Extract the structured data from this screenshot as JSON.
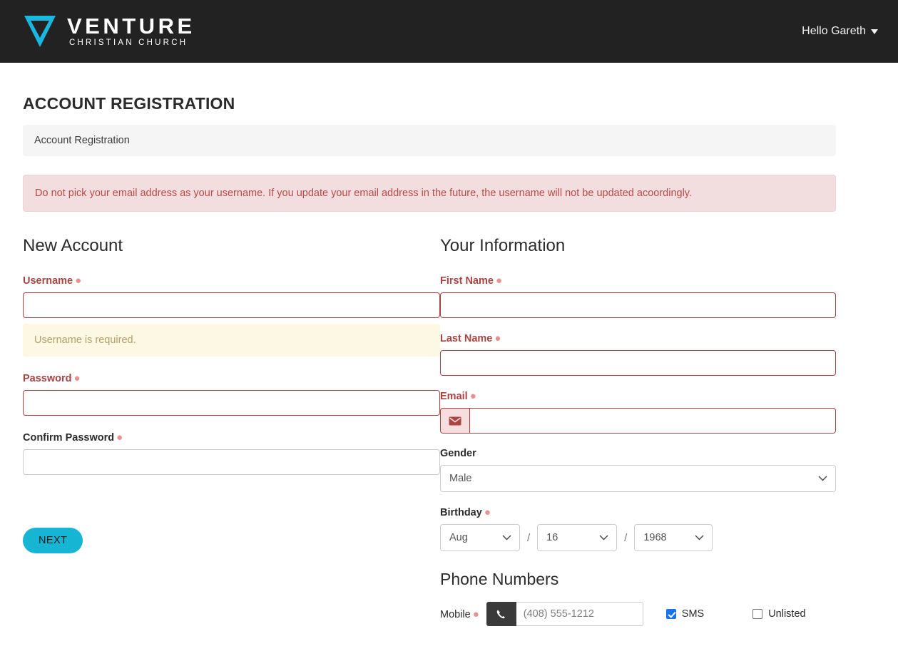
{
  "header": {
    "brand_name": "VENTURE",
    "brand_subtitle": "CHRISTIAN CHURCH",
    "logo_icon": "venture-v-logo",
    "user_greeting": "Hello Gareth",
    "caret_icon": "chevron-down-icon",
    "background_color": "#222222",
    "accent_color": "#17b5d4"
  },
  "page": {
    "title": "ACCOUNT REGISTRATION",
    "breadcrumb": "Account Registration",
    "alert": "Do not pick your email address as your username. If you update your email address in the future, the username will not be updated acoordingly.",
    "alert_color": "#b94a48",
    "alert_background": "#f2dede"
  },
  "new_account": {
    "heading": "New Account",
    "username": {
      "label": "Username",
      "required_marker": "●",
      "value": "",
      "placeholder": "",
      "error": "Username is required.",
      "error_background": "#fcf8e3",
      "error_color": "#b2a06a",
      "invalid": true
    },
    "password": {
      "label": "Password",
      "required_marker": "●",
      "value": "",
      "placeholder": "",
      "invalid": true
    },
    "confirm_password": {
      "label": "Confirm Password",
      "required_marker": "●",
      "value": "",
      "placeholder": "",
      "invalid": false
    }
  },
  "your_information": {
    "heading": "Your Information",
    "first_name": {
      "label": "First Name",
      "required_marker": "●",
      "value": "",
      "placeholder": ""
    },
    "last_name": {
      "label": "Last Name",
      "required_marker": "●",
      "value": "",
      "placeholder": ""
    },
    "email": {
      "label": "Email",
      "required_marker": "●",
      "value": "",
      "placeholder": "",
      "addon_icon": "envelope-icon"
    },
    "gender": {
      "label": "Gender",
      "selected": "Male",
      "chevron_icon": "chevron-down-icon"
    },
    "birthday": {
      "label": "Birthday",
      "required_marker": "●",
      "month": "Aug",
      "day": "16",
      "year": "1968",
      "separator": "/",
      "chevron_icon": "chevron-down-icon"
    }
  },
  "phone_numbers": {
    "heading": "Phone Numbers",
    "mobile": {
      "label": "Mobile",
      "required_marker": "●",
      "icon": "phone-icon",
      "value": "",
      "placeholder": "(408) 555-1212"
    },
    "sms": {
      "label": "SMS",
      "checked": true
    },
    "unlisted": {
      "label": "Unlisted",
      "checked": false
    },
    "checkbox_color": "#1a73e8"
  },
  "footer": {
    "next_label": "NEXT",
    "next_color": "#17b5d4"
  }
}
